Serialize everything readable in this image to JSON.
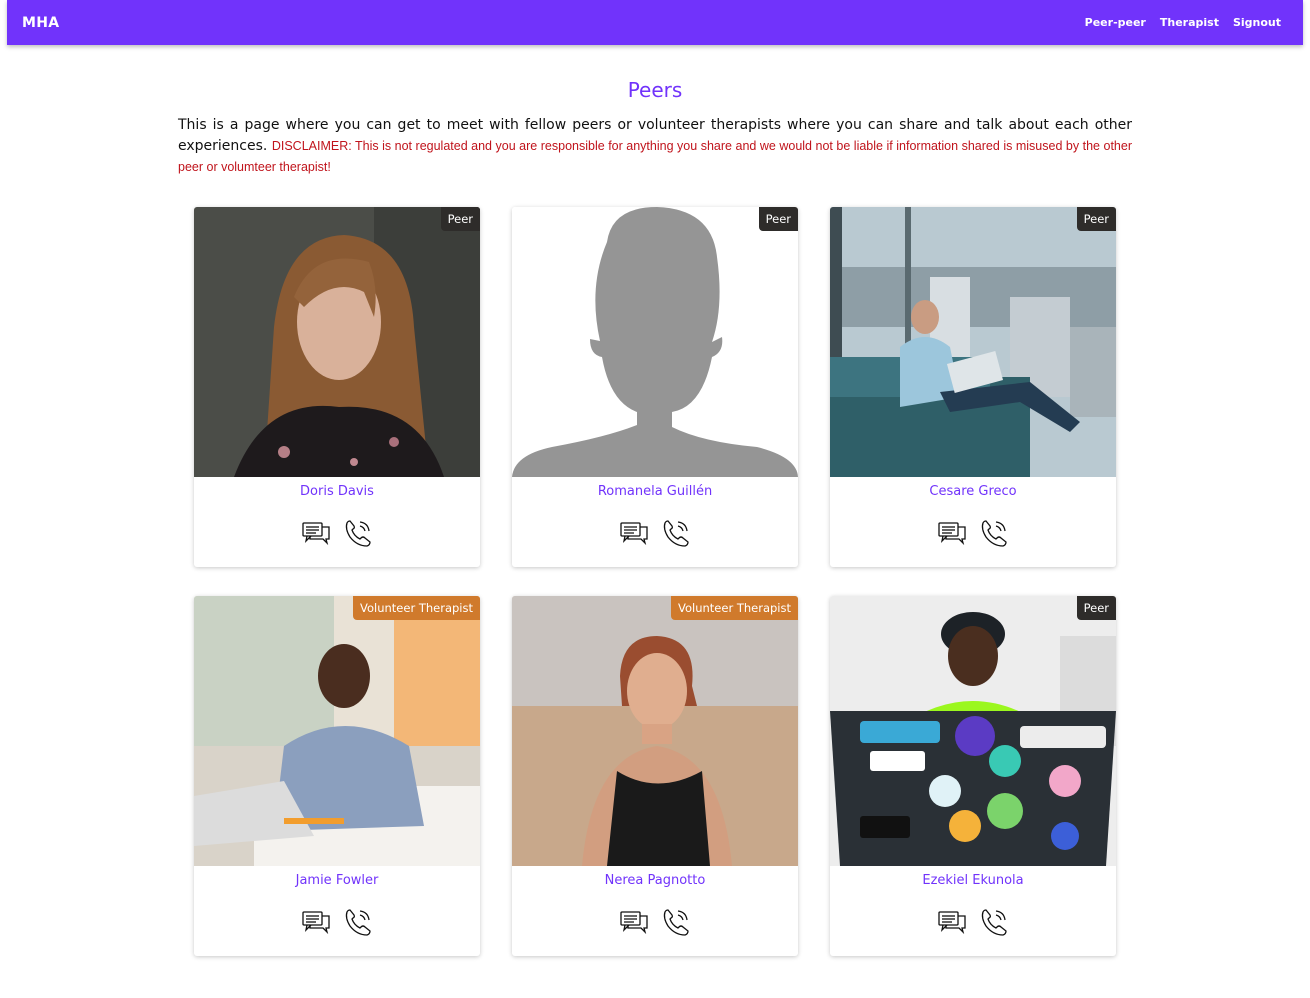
{
  "nav": {
    "brand": "MHA",
    "links": [
      "Peer-peer",
      "Therapist",
      "Signout"
    ]
  },
  "page": {
    "title": "Peers",
    "intro": "This is a page where you can get to meet with fellow peers or volunteer therapists where you can share and talk about each other experiences.",
    "disclaimer": "DISCLAIMER: This is not regulated and you are responsible for anything you share and we would not be liable if information shared is misused by the other peer or volumteer therapist!"
  },
  "colors": {
    "accent": "#7133fb",
    "disclaimer": "#c0141c",
    "peer_badge": "#2e2c2a",
    "therapist_badge": "#d07a2c"
  },
  "icons": {
    "chat": "chat-bubbles-icon",
    "call": "phone-call-icon"
  },
  "people": [
    {
      "name": "Doris Davis",
      "badge": "Peer"
    },
    {
      "name": "Romanela Guillén",
      "badge": "Peer"
    },
    {
      "name": "Cesare Greco",
      "badge": "Peer"
    },
    {
      "name": "Jamie Fowler",
      "badge": "Volunteer Therapist"
    },
    {
      "name": "Nerea Pagnotto",
      "badge": "Volunteer Therapist"
    },
    {
      "name": "Ezekiel Ekunola",
      "badge": "Peer"
    }
  ]
}
